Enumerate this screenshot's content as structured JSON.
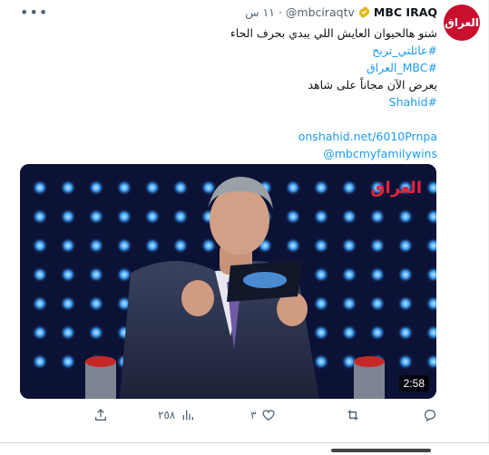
{
  "tweet": {
    "avatar_text": "العراق",
    "display_name": "MBC IRAQ",
    "handle": "@mbciraqtv",
    "time": "١١ س",
    "lines": [
      "شنو هالحيوان العايش اللي يبدي بحرف الحاء",
      "#عائلتي_تربح",
      "#MBC_العراق",
      "يعرض الآن مجاناً على شاهد",
      "#Shahid",
      "onshahid.net/6010Prnpa",
      "@mbcmyfamilywins"
    ],
    "video_duration": "2:58",
    "media_logo": "العراق"
  },
  "actions": {
    "reply_count": "",
    "retweet_count": "",
    "like_count": "٣",
    "view_count": "٢٥٨"
  },
  "colors": {
    "accent": "#1d9bf0",
    "muted": "#536471",
    "brand": "#c8102e"
  }
}
